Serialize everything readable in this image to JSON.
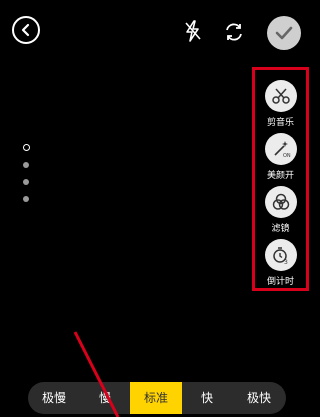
{
  "top_bar": {
    "back_icon": "chevron-left-icon",
    "flash_icon": "flash-off-icon",
    "switch_icon": "camera-switch-icon",
    "confirm_icon": "checkmark-icon"
  },
  "side_tools": [
    {
      "label": "剪音乐",
      "icon": "scissors-icon"
    },
    {
      "label": "美颜开",
      "icon": "magic-wand-icon"
    },
    {
      "label": "滤镜",
      "icon": "filter-icon"
    },
    {
      "label": "倒计时",
      "icon": "timer-icon"
    }
  ],
  "page_dots": {
    "count": 4,
    "active_index": 0
  },
  "speed_options": {
    "items": [
      "极慢",
      "慢",
      "标准",
      "快",
      "极快"
    ],
    "selected": "标准"
  },
  "colors": {
    "highlight_box": "#d9001b",
    "selected_speed": "#ffd300",
    "background": "#000000"
  }
}
